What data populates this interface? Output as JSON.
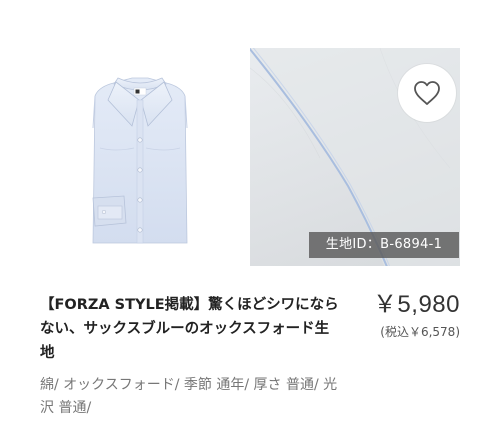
{
  "product": {
    "title": "【FORZA STYLE掲載】驚くほどシワにならない、サックスブルーのオックスフォード生地",
    "price": "￥5,980",
    "price_tax_included": "(税込￥6,578)",
    "fabric_id_label": "生地ID：B-6894-1",
    "specs": "綿/ オックスフォード/ 季節 通年/ 厚さ 普通/ 光沢 普通/"
  },
  "images": {
    "shirt": "light-blue-dress-shirt-folded",
    "fabric": "light-blue-oxford-fabric-closeup"
  },
  "icons": {
    "favorite": "heart-outline-icon"
  },
  "colors": {
    "shirt_fabric": "#dde6f5",
    "swatch_background": "#e1e4e7",
    "badge_background": "#5a5a5a",
    "text_primary": "#222222",
    "text_secondary": "#777777"
  }
}
